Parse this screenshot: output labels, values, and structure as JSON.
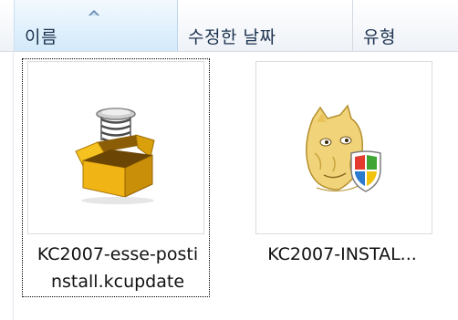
{
  "columns": [
    {
      "label": "이름",
      "sorted": "ascending"
    },
    {
      "label": "수정한 날짜"
    },
    {
      "label": "유형"
    }
  ],
  "files": [
    {
      "name_line1": "KC2007-esse-posti",
      "name_line2": "nstall.kcupdate",
      "icon": "package-box-icon",
      "selected": true
    },
    {
      "name": "KC2007-INSTAL...",
      "icon": "installer-shield-icon",
      "selected": false
    }
  ],
  "colors": {
    "header_text": "#1e3350",
    "sorted_column": "#dceefb",
    "box_yellow": "#e8b010",
    "shield_blue": "#2a7ad0",
    "shield_red": "#e33b2e",
    "shield_green": "#3fa535",
    "shield_yellow": "#f2c30e"
  }
}
